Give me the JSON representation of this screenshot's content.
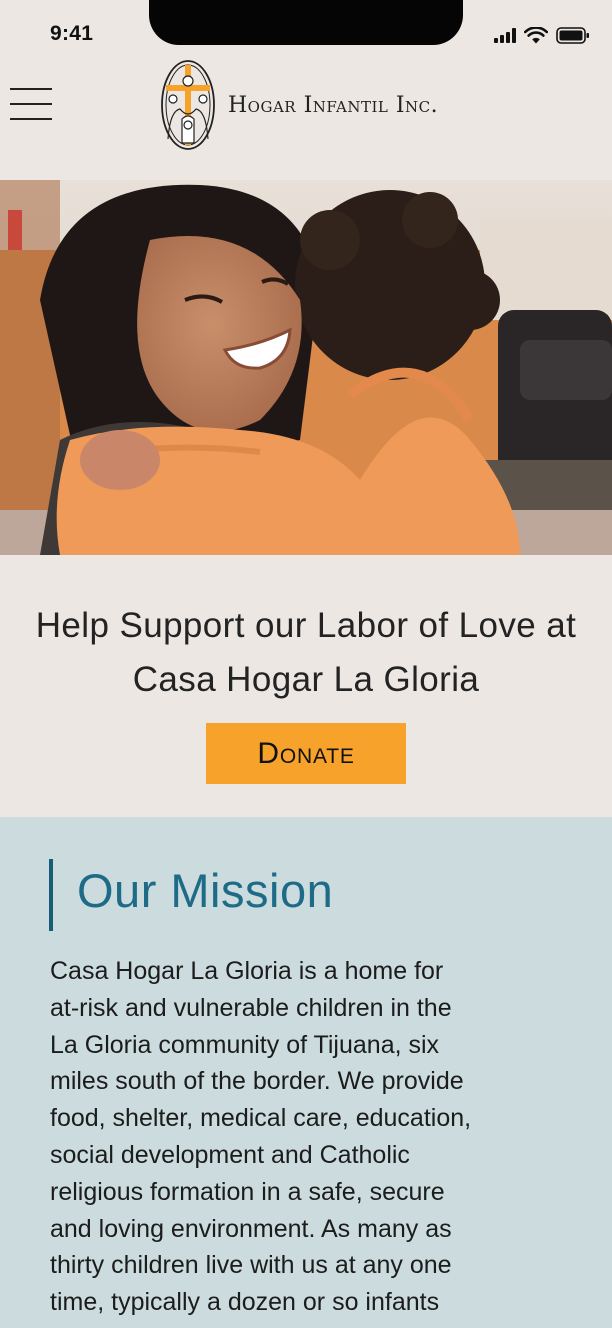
{
  "status_bar": {
    "time": "9:41",
    "icons": [
      "signal-icon",
      "wifi-icon",
      "battery-icon"
    ]
  },
  "header": {
    "menu_icon": "hamburger-menu-icon",
    "logo_icon": "hogar-infantil-logo",
    "org_name": "Hogar Infantil Inc."
  },
  "hero": {
    "image": "photo of a smiling woman hugging a child in an orange sweater"
  },
  "cta": {
    "headline": "Help Support our Labor of Love at Casa Hogar La Gloria",
    "donate_label": "Donate"
  },
  "mission": {
    "title": "Our Mission",
    "body": "Casa Hogar La Gloria is a home for\nat-risk and vulnerable children in the\nLa Gloria community of Tijuana, six\nmiles south of the border.  We provide\nfood, shelter, medical care, education,\nsocial development and Catholic\nreligious formation in a safe, secure\nand loving environment.  As many as\nthirty children live with us at any one\ntime, typically a dozen or so infants"
  },
  "colors": {
    "page_background": "#ece7e3",
    "donate_orange": "#f7a32b",
    "mission_background": "#cbdbde",
    "mission_accent": "#1d6b86"
  }
}
